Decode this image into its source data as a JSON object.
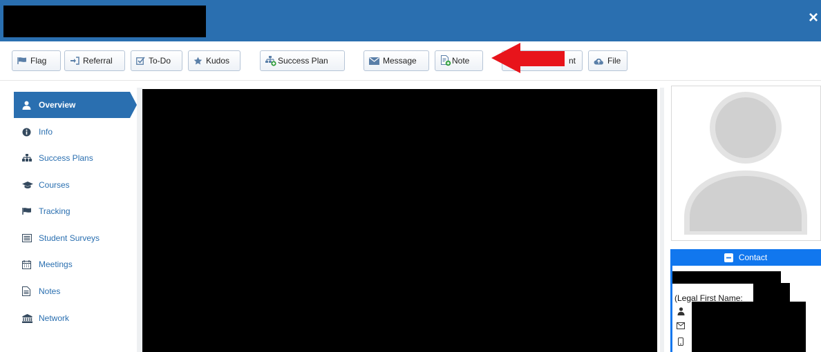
{
  "window": {
    "close_glyph": "×"
  },
  "toolbar": {
    "buttons": [
      {
        "label": "Flag",
        "icon": "flag-icon"
      },
      {
        "label": "Referral",
        "icon": "sign-in-icon"
      },
      {
        "label": "To-Do",
        "icon": "checkbox-icon"
      },
      {
        "label": "Kudos",
        "icon": "star-icon"
      },
      {
        "label": "Success Plan",
        "icon": "success-plan-icon"
      },
      {
        "label": "Message",
        "icon": "envelope-icon"
      },
      {
        "label": "Note",
        "icon": "note-add-icon"
      },
      {
        "label": "nt",
        "icon": "appointment-icon"
      },
      {
        "label": "File",
        "icon": "cloud-upload-icon"
      }
    ]
  },
  "sidebar": {
    "items": [
      {
        "label": "Overview",
        "icon": "user-icon",
        "active": true
      },
      {
        "label": "Info",
        "icon": "info-circle-icon"
      },
      {
        "label": "Success Plans",
        "icon": "sitemap-icon"
      },
      {
        "label": "Courses",
        "icon": "graduation-cap-icon"
      },
      {
        "label": "Tracking",
        "icon": "flag-icon"
      },
      {
        "label": "Student Surveys",
        "icon": "list-alt-icon"
      },
      {
        "label": "Meetings",
        "icon": "calendar-icon"
      },
      {
        "label": "Notes",
        "icon": "file-text-icon"
      },
      {
        "label": "Network",
        "icon": "university-icon"
      }
    ]
  },
  "contact": {
    "title": "Contact",
    "legal_first_name_label": "(Legal First Name:"
  },
  "colors": {
    "header_bar": "#2a6fb0",
    "accent_blue": "#1177ee",
    "arrow_red": "#e8141b",
    "link_blue": "#2a6fb0"
  }
}
